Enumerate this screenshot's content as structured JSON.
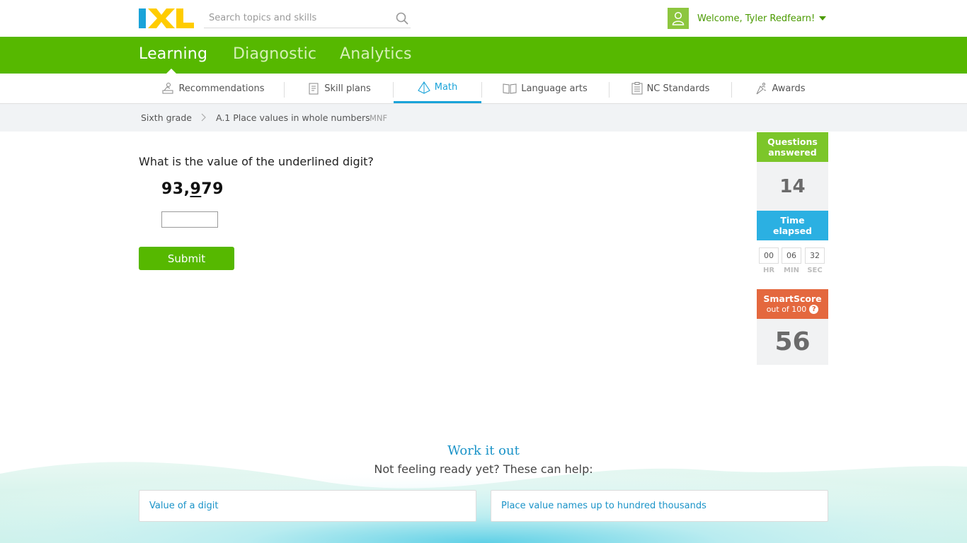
{
  "header": {
    "logo_text": "IXL",
    "search_placeholder": "Search topics and skills",
    "welcome": "Welcome, Tyler Redfearn!"
  },
  "main_nav": [
    {
      "label": "Learning",
      "active": true
    },
    {
      "label": "Diagnostic",
      "active": false
    },
    {
      "label": "Analytics",
      "active": false
    }
  ],
  "sub_nav": [
    {
      "label": "Recommendations",
      "icon": "recommendations-icon"
    },
    {
      "label": "Skill plans",
      "icon": "skill-plans-icon"
    },
    {
      "label": "Math",
      "icon": "math-icon",
      "active": true
    },
    {
      "label": "Language arts",
      "icon": "book-icon"
    },
    {
      "label": "NC Standards",
      "icon": "standards-icon"
    },
    {
      "label": "Awards",
      "icon": "awards-icon"
    }
  ],
  "breadcrumb": {
    "grade": "Sixth grade",
    "skill": "A.1 Place values in whole numbers",
    "code": "MNF"
  },
  "question": {
    "prompt": "What is the value of the underlined digit?",
    "number_before": "93,",
    "number_underlined": "9",
    "number_after": "79",
    "answer_value": "",
    "submit_label": "Submit"
  },
  "stats": {
    "questions_answered_label_1": "Questions",
    "questions_answered_label_2": "answered",
    "questions_answered": "14",
    "time_label_1": "Time",
    "time_label_2": "elapsed",
    "hours": "00",
    "minutes": "06",
    "seconds": "32",
    "hr_label": "HR",
    "min_label": "MIN",
    "sec_label": "SEC",
    "smartscore_label": "SmartScore",
    "smartscore_sub": "out of 100",
    "smartscore": "56"
  },
  "help": {
    "title": "Work it out",
    "subtitle": "Not feeling ready yet? These can help:",
    "links": [
      "Value of a digit",
      "Place value names up to hundred thousands"
    ]
  },
  "colors": {
    "green": "#56b800",
    "blue": "#1aa3d9",
    "orange": "#e4683e"
  }
}
